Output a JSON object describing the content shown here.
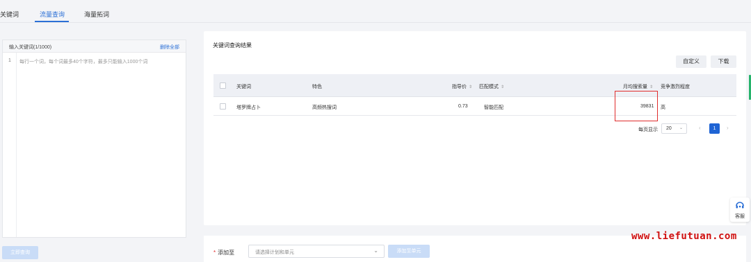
{
  "tabs": [
    {
      "label": "关键词"
    },
    {
      "label": "流量查询",
      "active": true
    },
    {
      "label": "海量拓词"
    }
  ],
  "left": {
    "title": "输入关键词(1/1000)",
    "delete_all": "删除全部",
    "line_no": "1",
    "placeholder": "每行一个词，每个词最多40个字符，最多只能输入1000个词",
    "query_button": "立即查询"
  },
  "results": {
    "title": "关键词查询结果",
    "custom_button": "自定义",
    "download_button": "下载",
    "columns": [
      "关键词",
      "特色",
      "指导价",
      "匹配模式",
      "月均搜索量",
      "竞争激烈程度"
    ],
    "rows": [
      {
        "keyword": "塔罗牌占卜",
        "feature": "高频热搜词",
        "price": "0.73",
        "match": "智能匹配",
        "monthly": "39831",
        "competition": "高"
      }
    ],
    "pager": {
      "label": "每页显示",
      "page_size": "20",
      "current_page": "1"
    }
  },
  "bottom": {
    "add_to_label": "添加至",
    "plan_placeholder": "请选择计划和单元",
    "add_button": "添加至单元"
  },
  "service": {
    "label": "客服"
  },
  "watermark": "www.liefutuan.com",
  "colors": {
    "accent": "#2b6fd6",
    "highlight": "#e02b2b",
    "watermark": "#d01010"
  }
}
